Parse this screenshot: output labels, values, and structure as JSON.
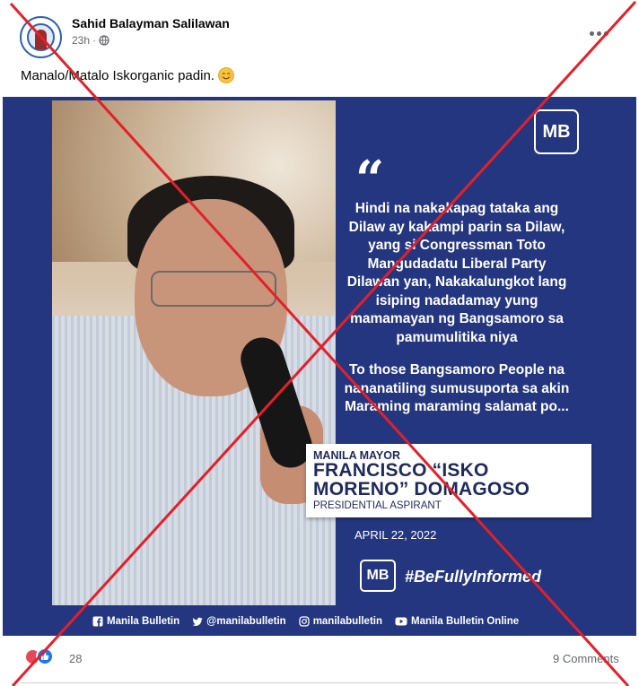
{
  "post": {
    "author": "Sahid Balayman Salilawan",
    "time": "23h",
    "separator": "·",
    "privacy_icon": "globe-icon",
    "caption": "Manalo/Matalo Iskorganic padin.",
    "caption_emoji": "smiling-face-icon"
  },
  "poster": {
    "brand_badge": "MB",
    "quote_mark": "“",
    "quote_paragraph_1": "Hindi na nakakapag tataka ang Dilaw ay kakampi parin sa Dilaw, yang si Congressman Toto Mangudadatu Liberal Party Dilawan yan, Nakakalungkot lang isiping nadadamay yung mamamayan ng Bangsamoro sa pamumulitika niya",
    "quote_paragraph_2": "To those Bangsamoro People na nananatiling sumusuporta sa akin Maraming maraming salamat po...",
    "speaker_role": "MANILA MAYOR",
    "speaker_name_line1": "FRANCISCO “ISKO",
    "speaker_name_line2": "MORENO” DOMAGOSO",
    "speaker_title": "PRESIDENTIAL ASPIRANT",
    "date": "APRIL 22, 2022",
    "hashtag_badge": "MB",
    "hashtag": "#BeFullyInformed",
    "socials": [
      {
        "icon": "facebook-icon",
        "label": "Manila Bulletin"
      },
      {
        "icon": "twitter-icon",
        "label": "@manilabulletin"
      },
      {
        "icon": "instagram-icon",
        "label": "manilabulletin"
      },
      {
        "icon": "youtube-icon",
        "label": "Manila Bulletin Online"
      }
    ],
    "colors": {
      "background": "#24367f",
      "text": "#ffffff",
      "name_text": "#1f2a5c",
      "x_overlay": "#e3202a"
    }
  },
  "footer": {
    "reaction_icons": [
      "love-icon",
      "like-icon"
    ],
    "reaction_count": "28",
    "comments": "9 Comments"
  }
}
